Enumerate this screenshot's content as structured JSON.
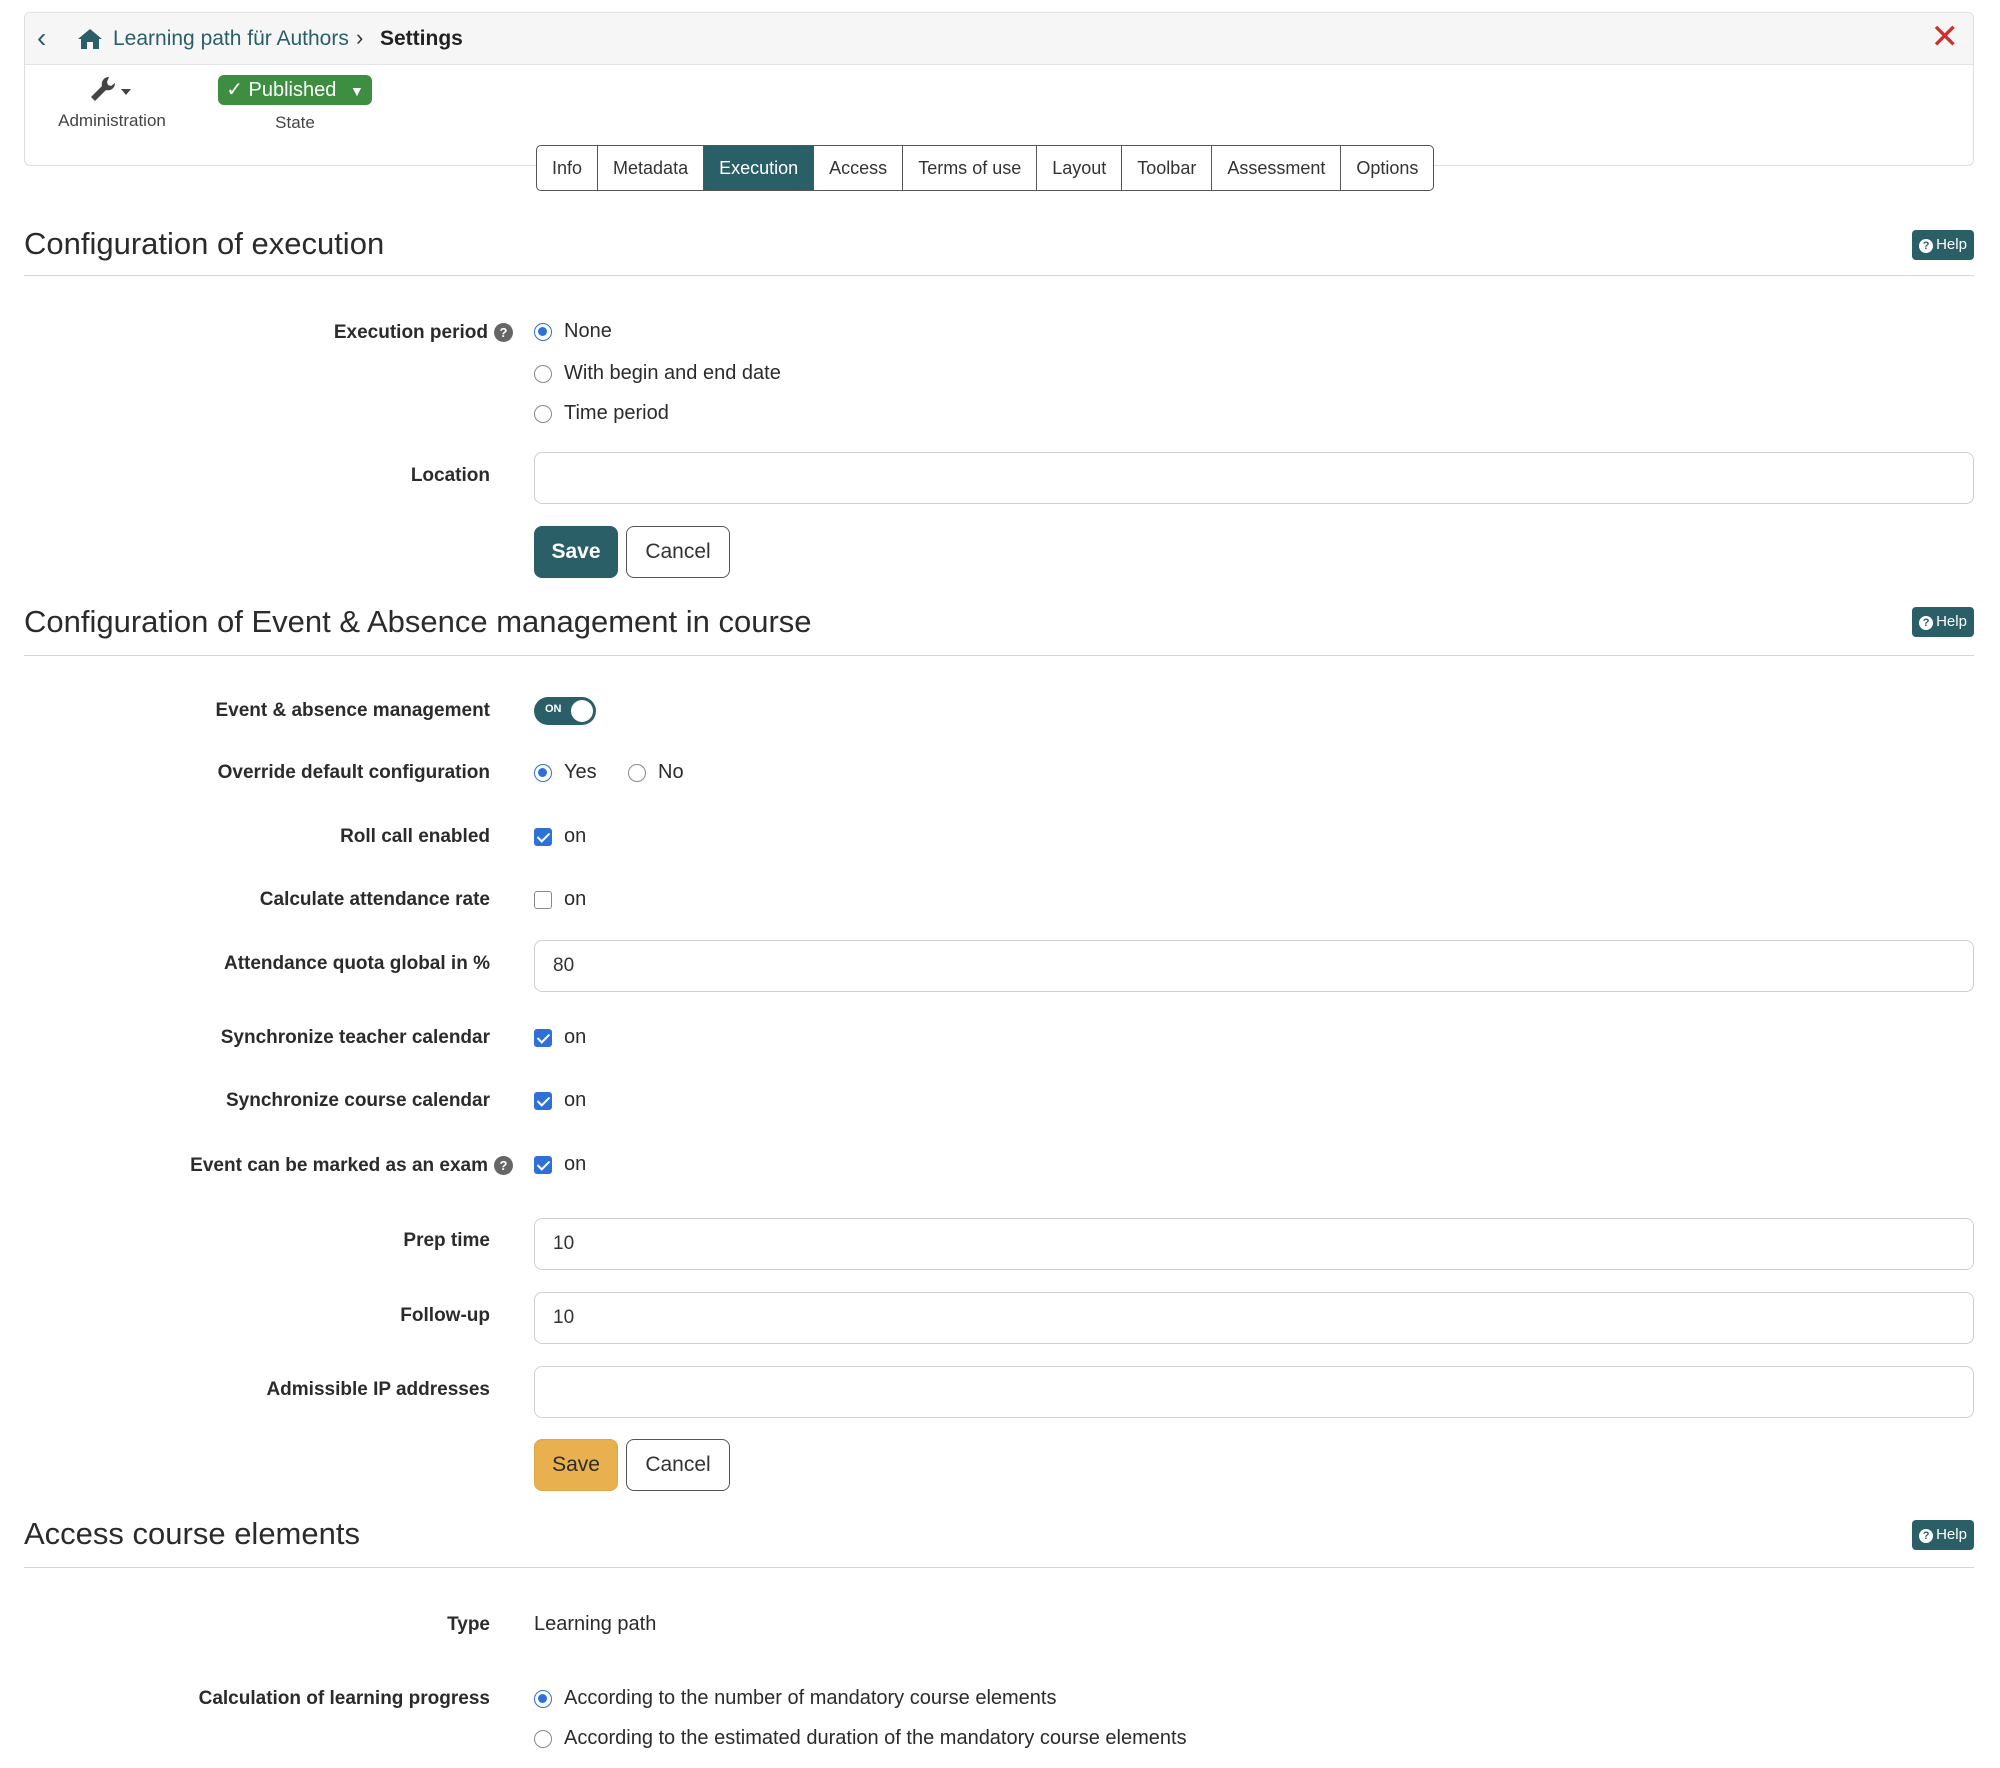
{
  "breadcrumb": {
    "course": "Learning path für Authors",
    "current": "Settings"
  },
  "toolbar": {
    "admin_label": "Administration",
    "state_value": "Published",
    "state_label": "State"
  },
  "tabs": [
    "Info",
    "Metadata",
    "Execution",
    "Access",
    "Terms of use",
    "Layout",
    "Toolbar",
    "Assessment",
    "Options"
  ],
  "active_tab": "Execution",
  "help_label": "Help",
  "execution": {
    "title": "Configuration of execution",
    "period_label": "Execution period",
    "period_options": [
      "None",
      "With begin and end date",
      "Time period"
    ],
    "period_selected": "None",
    "location_label": "Location",
    "location_value": "",
    "save_label": "Save",
    "cancel_label": "Cancel"
  },
  "event": {
    "title": "Configuration of Event & Absence management in course",
    "mgmt_label": "Event & absence management",
    "toggle_text": "ON",
    "override_label": "Override default configuration",
    "override_yes": "Yes",
    "override_no": "No",
    "override_selected": "Yes",
    "rollcall_label": "Roll call enabled",
    "rollcall_checked": true,
    "attendance_label": "Calculate attendance rate",
    "attendance_checked": false,
    "quota_label": "Attendance quota global in %",
    "quota_value": "80",
    "sync_teacher_label": "Synchronize teacher calendar",
    "sync_teacher_checked": true,
    "sync_course_label": "Synchronize course calendar",
    "sync_course_checked": true,
    "exam_label": "Event can be marked as an exam",
    "exam_checked": true,
    "on_text": "on",
    "prep_label": "Prep time",
    "prep_value": "10",
    "followup_label": "Follow-up",
    "followup_value": "10",
    "ip_label": "Admissible IP addresses",
    "ip_value": "",
    "save_label": "Save",
    "cancel_label": "Cancel"
  },
  "access": {
    "title": "Access course elements",
    "type_label": "Type",
    "type_value": "Learning path",
    "progress_label": "Calculation of learning progress",
    "progress_options": [
      "According to the number of mandatory course elements",
      "According to the estimated duration of the mandatory course elements"
    ],
    "progress_selected": "According to the number of mandatory course elements"
  },
  "colors": {
    "accent": "#2b5f68",
    "published": "#3e8e41",
    "save_yellow": "#e8b04e",
    "close": "#d0302a",
    "check": "#2e6fd8"
  }
}
